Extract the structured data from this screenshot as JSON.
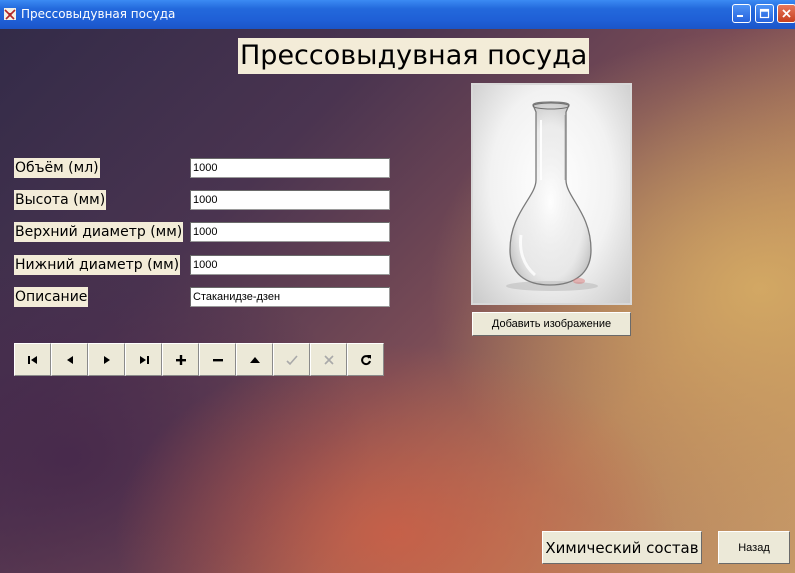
{
  "window": {
    "title": "Прессовыдувная посуда",
    "icon": "app-icon",
    "controls": {
      "minimize": "minimize-icon",
      "maximize": "maximize-icon",
      "close": "close-icon"
    }
  },
  "main": {
    "heading": "Прессовыдувная посуда"
  },
  "form": {
    "fields": [
      {
        "label": "Объём (мл)",
        "value": "1000"
      },
      {
        "label": "Высота (мм)",
        "value": "1000"
      },
      {
        "label": "Верхний диаметр (мм)",
        "value": "1000"
      },
      {
        "label": "Нижний диаметр (мм)",
        "value": "1000"
      },
      {
        "label": "Описание",
        "value": "Стаканидзе-дзен"
      }
    ]
  },
  "navigator": {
    "buttons": [
      {
        "icon": "first-record-icon",
        "enabled": true
      },
      {
        "icon": "prior-record-icon",
        "enabled": true
      },
      {
        "icon": "next-record-icon",
        "enabled": true
      },
      {
        "icon": "last-record-icon",
        "enabled": true
      },
      {
        "icon": "insert-record-icon",
        "enabled": true
      },
      {
        "icon": "delete-record-icon",
        "enabled": true
      },
      {
        "icon": "edit-record-icon",
        "enabled": true
      },
      {
        "icon": "post-record-icon",
        "enabled": false
      },
      {
        "icon": "cancel-edit-icon",
        "enabled": false
      },
      {
        "icon": "refresh-icon",
        "enabled": true
      }
    ]
  },
  "image_panel": {
    "subject": "glass-flask-photo",
    "add_image_label": "Добавить изображение"
  },
  "footer": {
    "chem_label": "Химический состав",
    "back_label": "Назад"
  },
  "colors": {
    "titlebar": "#2369dc",
    "label_bg": "#f3ecd8",
    "button_face": "#ece9d8",
    "close_button": "#c6401f"
  }
}
